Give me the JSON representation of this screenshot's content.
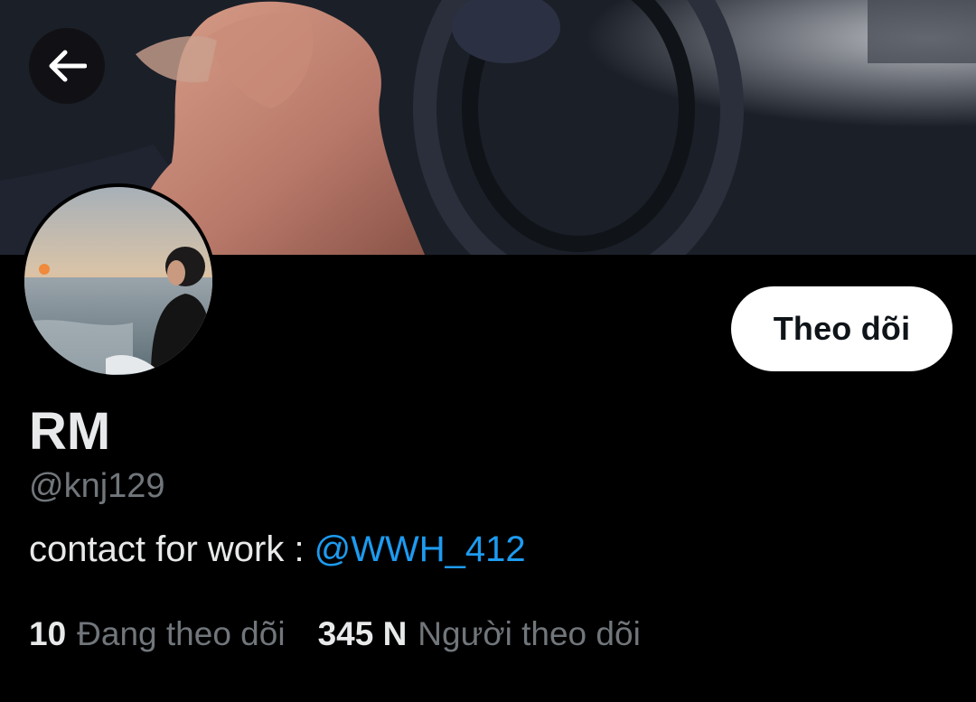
{
  "header": {
    "back_icon": "arrow-left-icon"
  },
  "profile": {
    "display_name": "RM",
    "handle": "@knj129",
    "bio_text": "contact for work : ",
    "bio_mention": "@WWH_412",
    "follow_label": "Theo dõi"
  },
  "stats": {
    "following_count": "10",
    "following_label": "Đang theo dõi",
    "followers_count": "345 N",
    "followers_label": "Người theo dõi"
  },
  "colors": {
    "background": "#000000",
    "text_primary": "#e7e9ea",
    "text_secondary": "#71767b",
    "link": "#1d9bf0",
    "follow_button_bg": "#ffffff"
  }
}
